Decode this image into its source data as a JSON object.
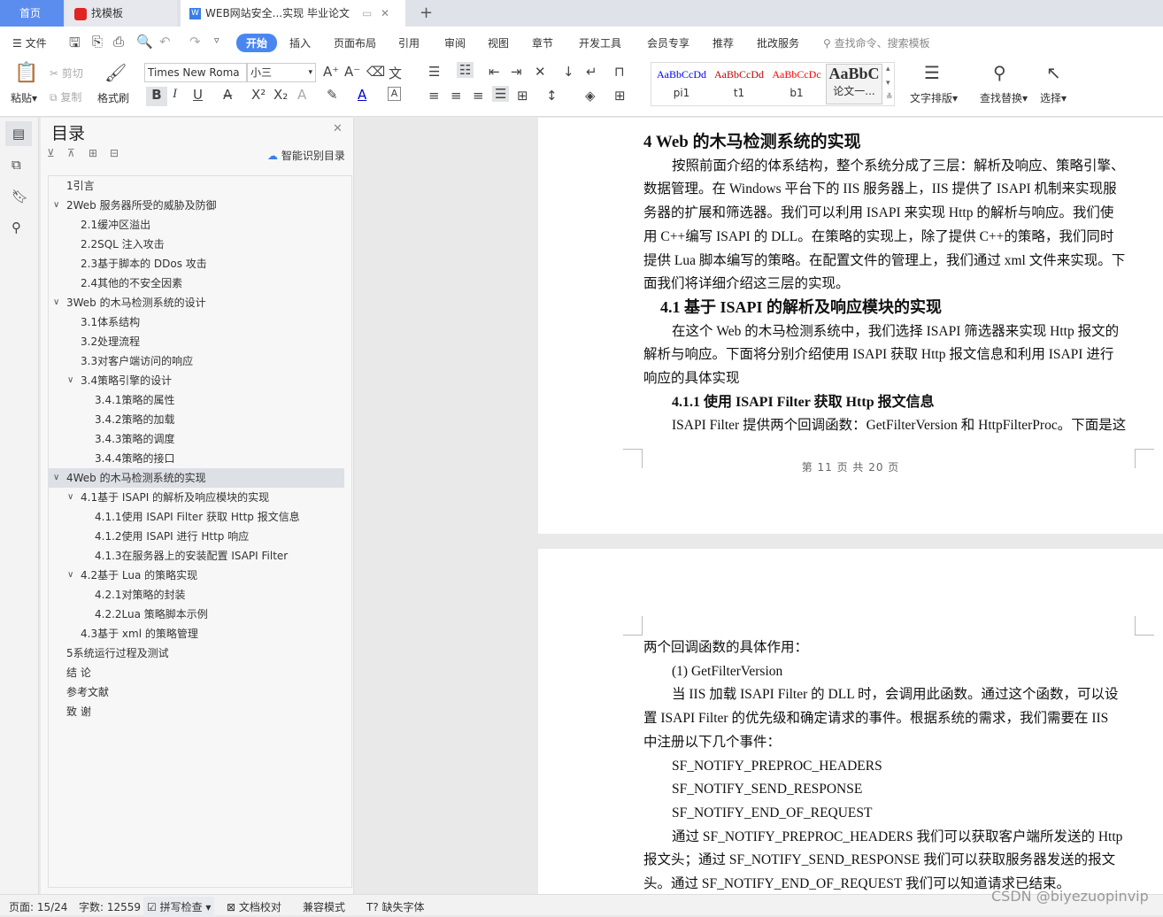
{
  "tabs": [
    {
      "label": "首页"
    },
    {
      "label": "找模板"
    },
    {
      "label": "WEB网站安全...实现 毕业论文"
    }
  ],
  "menu": {
    "file": "文件",
    "items": [
      "开始",
      "插入",
      "页面布局",
      "引用",
      "审阅",
      "视图",
      "章节",
      "开发工具",
      "会员专享",
      "推荐",
      "批改服务"
    ],
    "search_placeholder": "查找命令、搜索模板",
    "active": "开始"
  },
  "ribbon": {
    "paste": "粘贴",
    "cut": "剪切",
    "copy": "复制",
    "format_painter": "格式刷",
    "font": "Times New Roma",
    "size": "小三",
    "styles": [
      {
        "sample": "AaBbCcDd",
        "name": "pi1",
        "color": "#0000ff"
      },
      {
        "sample": "AaBbCcDd",
        "name": "t1",
        "color": "#c00000"
      },
      {
        "sample": "AaBbCcDc",
        "name": "b1",
        "color": "#ff0000"
      },
      {
        "sample": "AaBbC",
        "name": "论文一...",
        "color": "#000000"
      }
    ],
    "text_layout": "文字排版",
    "find_replace": "查找替换",
    "select": "选择"
  },
  "toc": {
    "title": "目录",
    "smart": "智能识别目录",
    "items": [
      {
        "label": "1引言",
        "level": 0,
        "toggle": false
      },
      {
        "label": "2Web 服务器所受的威胁及防御",
        "level": 0,
        "toggle": true
      },
      {
        "label": "2.1缓冲区溢出",
        "level": 1,
        "toggle": false
      },
      {
        "label": "2.2SQL 注入攻击",
        "level": 1,
        "toggle": false
      },
      {
        "label": "2.3基于脚本的 DDos 攻击",
        "level": 1,
        "toggle": false
      },
      {
        "label": "2.4其他的不安全因素",
        "level": 1,
        "toggle": false
      },
      {
        "label": "3Web 的木马检测系统的设计",
        "level": 0,
        "toggle": true
      },
      {
        "label": "3.1体系结构",
        "level": 1,
        "toggle": false
      },
      {
        "label": "3.2处理流程",
        "level": 1,
        "toggle": false
      },
      {
        "label": "3.3对客户端访问的响应",
        "level": 1,
        "toggle": false
      },
      {
        "label": "3.4策略引擎的设计",
        "level": 1,
        "toggle": true
      },
      {
        "label": "3.4.1策略的属性",
        "level": 2,
        "toggle": false
      },
      {
        "label": "3.4.2策略的加载",
        "level": 2,
        "toggle": false
      },
      {
        "label": "3.4.3策略的调度",
        "level": 2,
        "toggle": false
      },
      {
        "label": "3.4.4策略的接口",
        "level": 2,
        "toggle": false
      },
      {
        "label": "4Web 的木马检测系统的实现",
        "level": 0,
        "toggle": true,
        "selected": true
      },
      {
        "label": "4.1基于 ISAPI  的解析及响应模块的实现",
        "level": 1,
        "toggle": true
      },
      {
        "label": "4.1.1使用 ISAPI Filter 获取 Http 报文信息",
        "level": 2,
        "toggle": false
      },
      {
        "label": "4.1.2使用 ISAPI 进行 Http 响应",
        "level": 2,
        "toggle": false
      },
      {
        "label": "4.1.3在服务器上的安装配置 ISAPI Filter",
        "level": 2,
        "toggle": false
      },
      {
        "label": "4.2基于 Lua 的策略实现",
        "level": 1,
        "toggle": true
      },
      {
        "label": "4.2.1对策略的封装",
        "level": 2,
        "toggle": false
      },
      {
        "label": "4.2.2Lua 策略脚本示例",
        "level": 2,
        "toggle": false
      },
      {
        "label": "4.3基于 xml 的策略管理",
        "level": 1,
        "toggle": false
      },
      {
        "label": "5系统运行过程及测试",
        "level": 0,
        "toggle": false
      },
      {
        "label": "结    论",
        "level": 0,
        "toggle": false
      },
      {
        "label": "参考文献",
        "level": 0,
        "toggle": false
      },
      {
        "label": "致    谢",
        "level": 0,
        "toggle": false
      }
    ]
  },
  "page1": {
    "lines": [
      {
        "text": "4    Web 的木马检测系统的实现",
        "style": "h1"
      },
      {
        "text": "按照前面介绍的体系结构，整个系统分成了三层：解析及响应、策略引擎、",
        "style": "indent"
      },
      {
        "text": "数据管理。在 Windows 平台下的 IIS 服务器上，IIS 提供了 ISAPI 机制来实现服",
        "style": ""
      },
      {
        "text": "务器的扩展和筛选器。我们可以利用 ISAPI 来实现 Http 的解析与响应。我们使",
        "style": ""
      },
      {
        "text": "用 C++编写 ISAPI 的 DLL。在策略的实现上，除了提供 C++的策略，我们同时",
        "style": ""
      },
      {
        "text": "提供 Lua 脚本编写的策略。在配置文件的管理上，我们通过 xml 文件来实现。下",
        "style": ""
      },
      {
        "text": "面我们将详细介绍这三层的实现。",
        "style": ""
      },
      {
        "text": "4.1 基于 ISAPI  的解析及响应模块的实现",
        "style": "h2"
      },
      {
        "text": "在这个 Web 的木马检测系统中，我们选择 ISAPI 筛选器来实现 Http 报文的",
        "style": "indent"
      },
      {
        "text": "解析与响应。下面将分别介绍使用 ISAPI 获取 Http 报文信息和利用 ISAPI 进行",
        "style": ""
      },
      {
        "text": "响应的具体实现",
        "style": ""
      },
      {
        "text": "4.1.1    使用 ISAPI Filter 获取 Http 报文信息",
        "style": "h3"
      },
      {
        "text": "ISAPI Filter 提供两个回调函数：GetFilterVersion 和 HttpFilterProc。下面是这",
        "style": "indent"
      }
    ],
    "footer": "第 11 页 共 20 页"
  },
  "page2": {
    "lines": [
      {
        "text": "两个回调函数的具体作用：",
        "style": ""
      },
      {
        "text": "(1)  GetFilterVersion",
        "style": "indent"
      },
      {
        "text": "当 IIS 加载 ISAPI Filter 的 DLL 时，会调用此函数。通过这个函数，可以设",
        "style": "indent"
      },
      {
        "text": "置 ISAPI Filter 的优先级和确定请求的事件。根据系统的需求，我们需要在 IIS",
        "style": ""
      },
      {
        "text": "中注册以下几个事件：",
        "style": ""
      },
      {
        "text": "SF_NOTIFY_PREPROC_HEADERS",
        "style": "indent"
      },
      {
        "text": "SF_NOTIFY_SEND_RESPONSE",
        "style": "indent"
      },
      {
        "text": "SF_NOTIFY_END_OF_REQUEST",
        "style": "indent"
      },
      {
        "text": "通过 SF_NOTIFY_PREPROC_HEADERS 我们可以获取客户端所发送的 Http",
        "style": "indent"
      },
      {
        "text": "报文头；通过 SF_NOTIFY_SEND_RESPONSE 我们可以获取服务器发送的报文",
        "style": ""
      },
      {
        "text": "头。通过 SF_NOTIFY_END_OF_REQUEST 我们可以知道请求已结束。",
        "style": ""
      }
    ]
  },
  "status": {
    "page": "页面: 15/24",
    "words": "字数: 12559",
    "spell": "拼写检查",
    "proof": "文档校对",
    "compat": "兼容模式",
    "missing_font": "缺失字体"
  },
  "watermark": "CSDN @biyezuopinvip",
  "colors": {
    "accent": "#4a86ef",
    "home_tab": "#5b8def"
  }
}
